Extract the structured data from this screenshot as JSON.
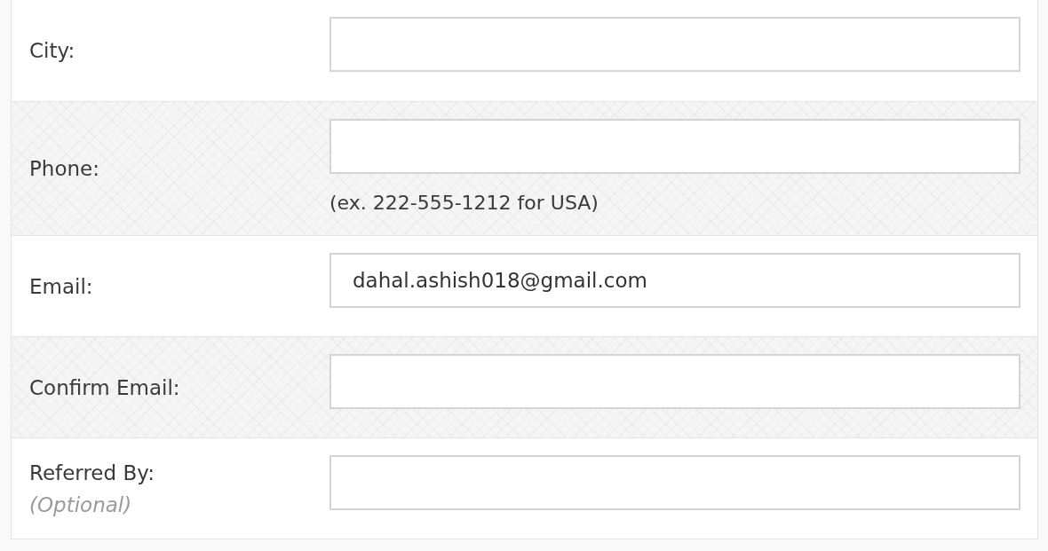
{
  "form_rows": [
    {
      "label": "City:"
    },
    {
      "label": "Phone:",
      "hint": "(ex. 222-555-1212 for USA)"
    },
    {
      "label": "Email:",
      "value": "dahal.ashish018@gmail.com"
    },
    {
      "label": "Confirm Email:"
    },
    {
      "label": "Referred By:",
      "note": "(Optional)"
    }
  ]
}
